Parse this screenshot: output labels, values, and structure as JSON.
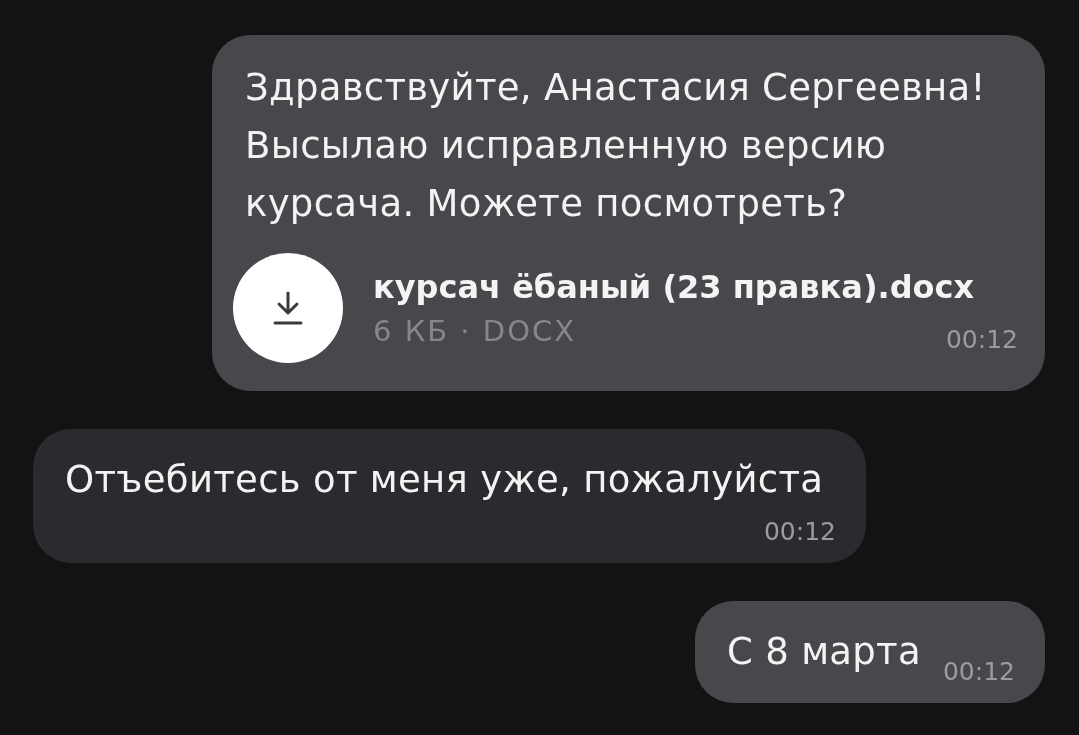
{
  "messages": [
    {
      "kind": "outgoing",
      "text": "Здравствуйте, Анастасия Сергеевна! Высылаю исправленную версию курсача. Можете посмотреть?",
      "attachment": {
        "name": "курсач ёбаный (23 правка).docx",
        "meta": "6 КБ · DOCX"
      },
      "time": "00:12"
    },
    {
      "kind": "incoming",
      "text": "Отъебитесь от меня уже, пожалуйста",
      "time": "00:12"
    },
    {
      "kind": "outgoing",
      "text": "С 8 марта",
      "time": "00:12"
    }
  ]
}
